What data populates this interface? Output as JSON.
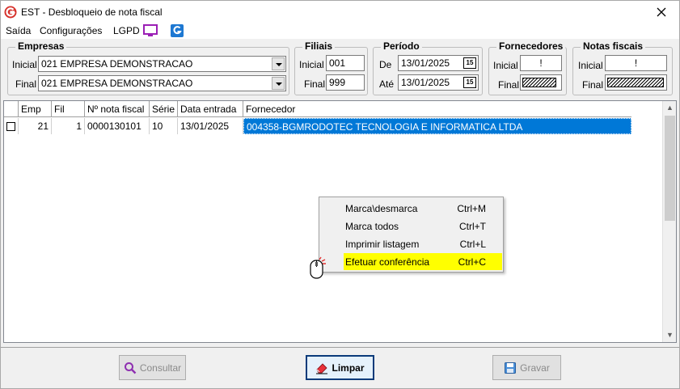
{
  "window": {
    "title": "EST - Desbloqueio de nota fiscal",
    "close_glyph": "✕"
  },
  "menu": {
    "items": [
      "Saída",
      "Configurações",
      "LGPD"
    ]
  },
  "filters": {
    "empresas": {
      "title": "Empresas",
      "inicial_label": "Inicial",
      "final_label": "Final",
      "inicial_value": "021 EMPRESA DEMONSTRACAO",
      "final_value": "021 EMPRESA DEMONSTRACAO"
    },
    "filiais": {
      "title": "Filiais",
      "inicial_label": "Inicial",
      "final_label": "Final",
      "inicial_value": "001",
      "final_value": "999"
    },
    "periodo": {
      "title": "Período",
      "de_label": "De",
      "ate_label": "Até",
      "de_value": "13/01/2025",
      "ate_value": "13/01/2025",
      "cal_glyph": "15"
    },
    "fornecedores": {
      "title": "Fornecedores",
      "inicial_label": "Inicial",
      "final_label": "Final",
      "inicial_value": "!"
    },
    "notas": {
      "title": "Notas fiscais",
      "inicial_label": "Inicial",
      "final_label": "Final",
      "inicial_value": "!"
    }
  },
  "grid": {
    "columns": [
      "Emp",
      "Fil",
      "Nº nota fiscal",
      "Série",
      "Data entrada",
      "Fornecedor"
    ],
    "rows": [
      {
        "emp": "21",
        "fil": "1",
        "nota": "0000130101",
        "serie": "10",
        "data": "13/01/2025",
        "fornecedor": "004358-BGMRODOTEC TECNOLOGIA E INFORMATICA LTDA"
      }
    ]
  },
  "context_menu": {
    "items": [
      {
        "label": "Marca\\desmarca",
        "shortcut": "Ctrl+M"
      },
      {
        "label": "Marca todos",
        "shortcut": "Ctrl+T"
      },
      {
        "label": "Imprimir listagem",
        "shortcut": "Ctrl+L"
      },
      {
        "label": "Efetuar conferência",
        "shortcut": "Ctrl+C"
      }
    ]
  },
  "buttons": {
    "consultar": "Consultar",
    "limpar": "Limpar",
    "gravar": "Gravar"
  },
  "colors": {
    "selection": "#0078d7",
    "highlight": "#ffff00",
    "brand": "#d6312b",
    "lgpd": "#9b1fb5",
    "app_icon_blue": "#1e78d2"
  },
  "icons": [
    "app-logo-icon",
    "close-icon",
    "monitor-icon",
    "g-app-icon",
    "dropdown-icon",
    "calendar-icon",
    "search-icon",
    "eraser-icon",
    "save-icon",
    "mouse-cursor-icon"
  ]
}
